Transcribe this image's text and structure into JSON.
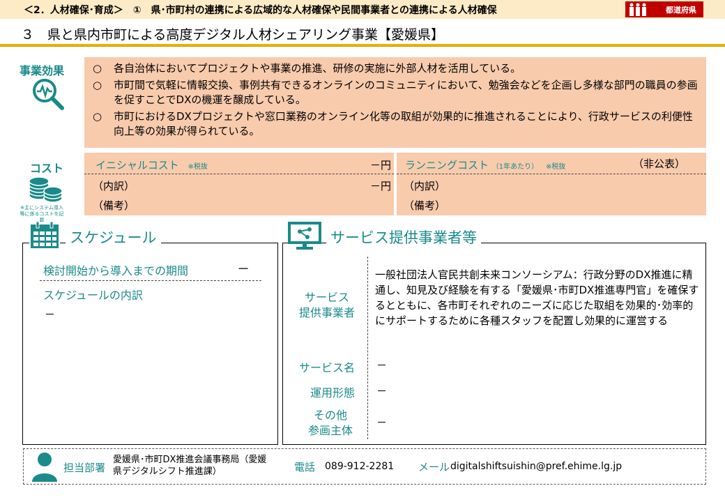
{
  "header": {
    "breadcrumb": "＜2．人材確保･育成＞　①　県･市町村の連携による広域的な人材確保や民間事業者との連携による人材確保",
    "badge_label": "都道府県"
  },
  "title": "３　県と県内市町による高度デジタル人材シェアリング事業【愛媛県】",
  "effects": {
    "label": "事業効果",
    "items": [
      {
        "mark": "○",
        "text": "各自治体においてプロジェクトや事業の推進、研修の実施に外部人材を活用している。"
      },
      {
        "mark": "○",
        "text": "市町間で気軽に情報交換、事例共有できるオンラインのコミュニティにおいて、勉強会などを企画し多様な部門の職員の参画を促すことでDXの機運を醸成している。"
      },
      {
        "mark": "○",
        "text": "市町におけるDXプロジェクトや窓口業務のオンライン化等の取組が効果的に推進されることにより、行政サービスの利便性向上等の効果が得られている。"
      }
    ]
  },
  "cost": {
    "label": "コスト",
    "note": "※主にシステム導入等に係るコストを記載",
    "initial": {
      "title": "イニシャルコスト",
      "tax_note": "※税抜",
      "value": "－円",
      "breakdown_label": "（内訳）",
      "breakdown_value": "－円",
      "remarks_label": "（備考）"
    },
    "running": {
      "title": "ランニングコスト",
      "per_year": "（1年あたり）",
      "tax_note": "※税抜",
      "value": "（非公表）",
      "breakdown_label": "（内訳）",
      "remarks_label": "（備考）"
    }
  },
  "schedule": {
    "title": "スケジュール",
    "period_label": "検討開始から導入までの期間",
    "period_value": "－",
    "breakdown_label": "スケジュールの内訳",
    "breakdown_value": "－"
  },
  "provider": {
    "title": "サービス提供事業者等",
    "rows": [
      {
        "label": "サービス\n提供事業者",
        "value": "一般社団法人官民共創未来コンソーシアム：行政分野のDX推進に精通し、知見及び経験を有する「愛媛県･市町DX推進専門官」を確保するとともに、各市町それぞれのニーズに応じた取組を効果的･効率的にサポートするために各種スタッフを配置し効果的に運営する"
      },
      {
        "label": "サービス名",
        "value": "－"
      },
      {
        "label": "運用形態",
        "value": "－"
      },
      {
        "label": "その他\n参画主体",
        "value": "－"
      }
    ]
  },
  "contact": {
    "dept_label": "担当部署",
    "dept_value": "愛媛県･市町DX推進会議事務局（愛媛\n県デジタルシフト推進課）",
    "phone_label": "電話",
    "phone_value": "089-912-2281",
    "mail_label": "メール",
    "mail_value": "digitalshiftsuishin@pref.ehime.lg.jp"
  },
  "colors": {
    "accent_teal": "#1a8a8a",
    "box_salmon": "#f8cbad",
    "header_cream": "#fdebc7",
    "title_rule": "#e8b400",
    "badge_red": "#c00000"
  },
  "icons": [
    "people-icon",
    "magnifier-chart-icon",
    "coins-icon",
    "calendar-icon",
    "monitor-icon",
    "person-icon"
  ]
}
